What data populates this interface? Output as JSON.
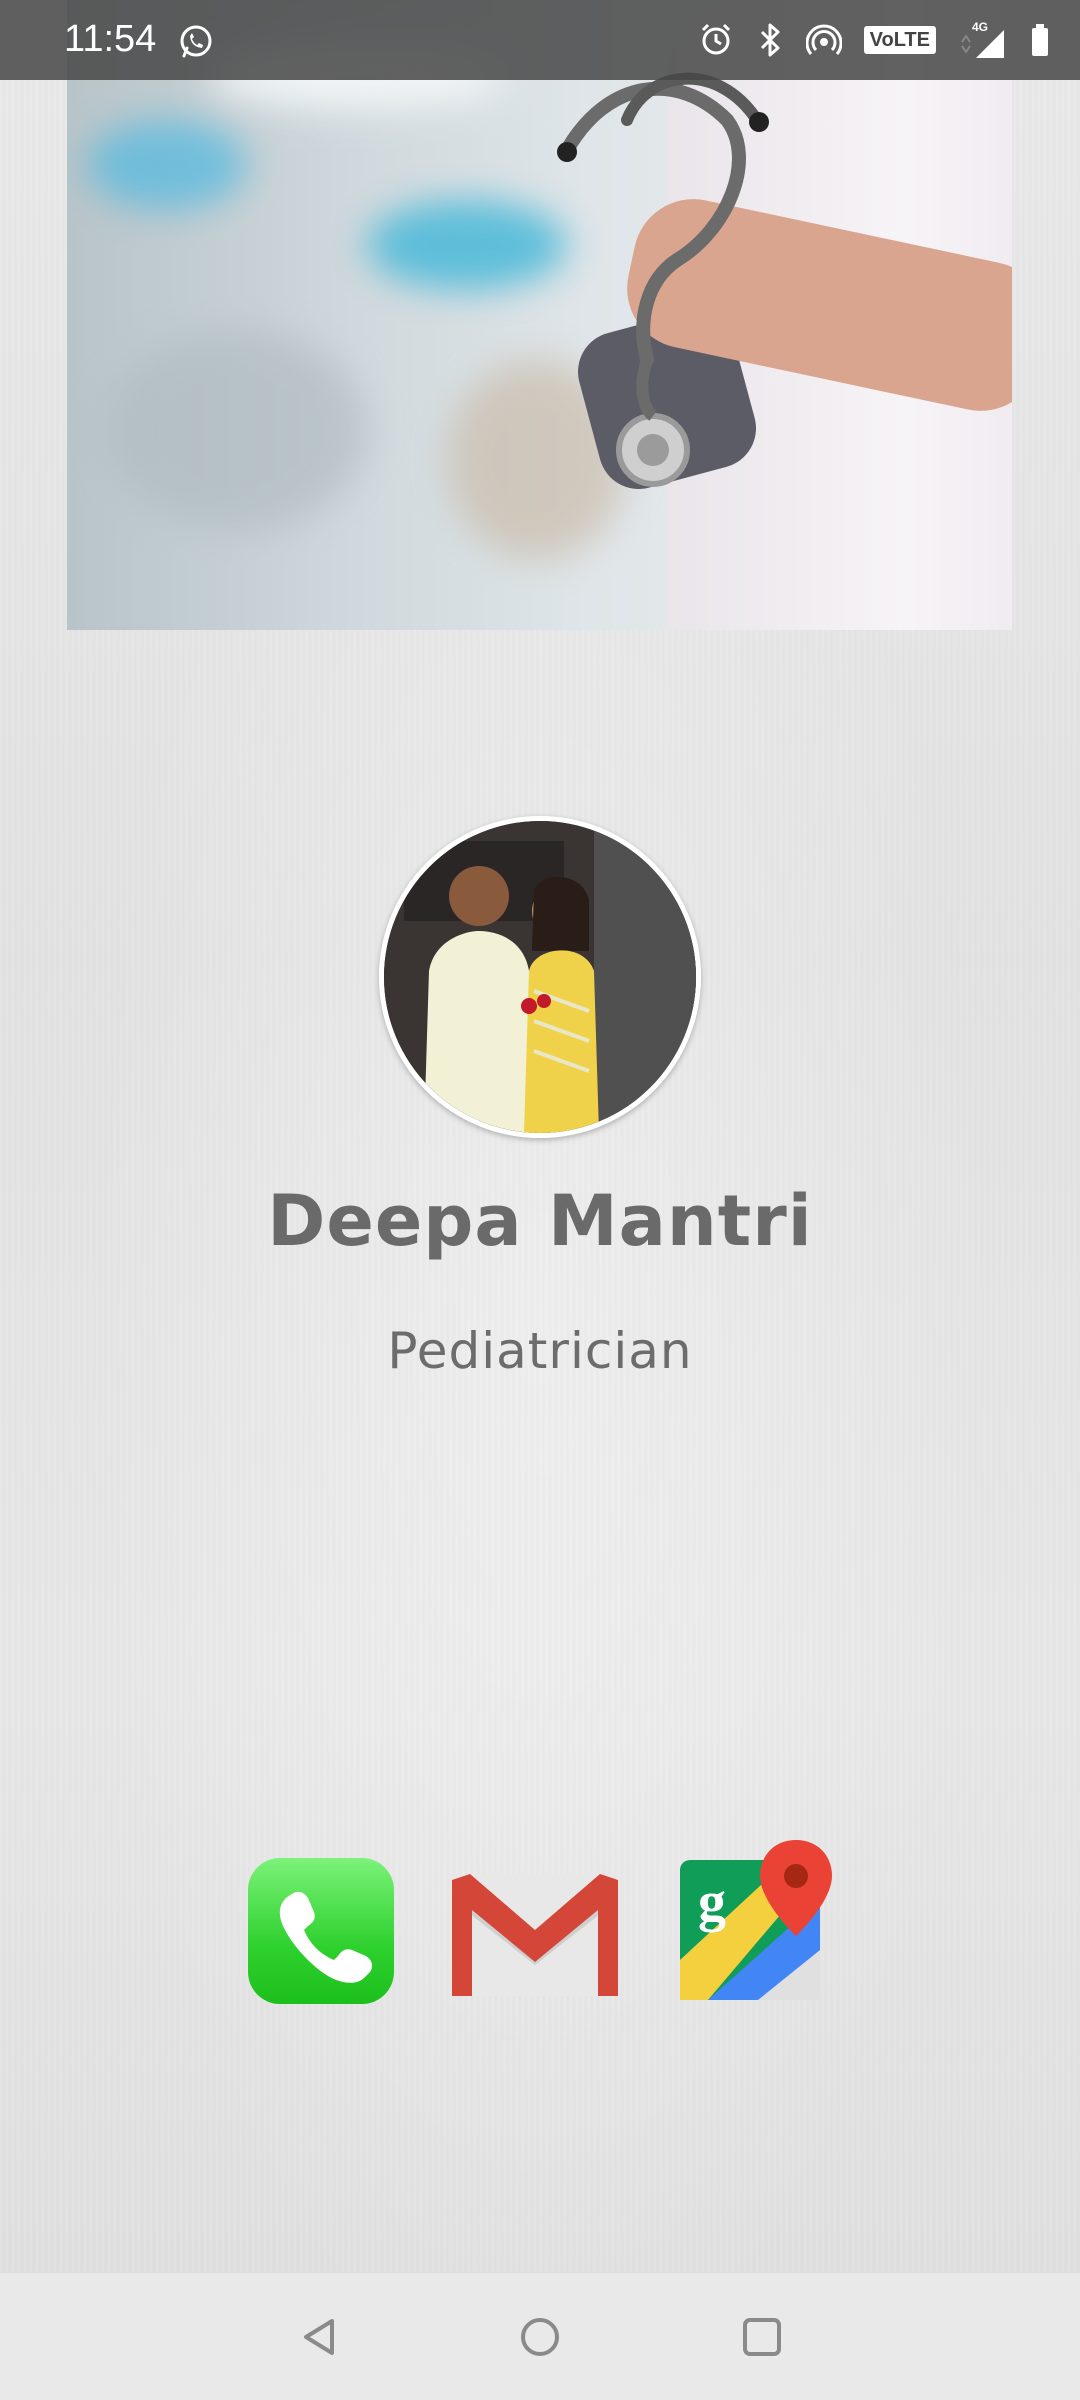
{
  "status_bar": {
    "time": "11:54",
    "notification_icons": [
      "whatsapp-icon"
    ],
    "system_icons": [
      "alarm-icon",
      "bluetooth-icon",
      "hotspot-icon",
      "volte-icon",
      "signal-4g-icon",
      "battery-icon"
    ],
    "volte_label": "VoLTE",
    "network_label": "4G"
  },
  "profile": {
    "name": "Deepa Mantri",
    "specialty": "Pediatrician"
  },
  "actions": [
    {
      "name": "phone",
      "icon": "phone-icon"
    },
    {
      "name": "email",
      "icon": "gmail-icon"
    },
    {
      "name": "maps",
      "icon": "google-maps-icon"
    }
  ],
  "nav_bar": {
    "buttons": [
      "back",
      "home",
      "recents"
    ]
  },
  "colors": {
    "name_text": "#6a6a6a",
    "background": "#e6e6e6",
    "phone_green": "#2fd12f",
    "gmail_red": "#d44638",
    "maps_red": "#ea4335"
  }
}
